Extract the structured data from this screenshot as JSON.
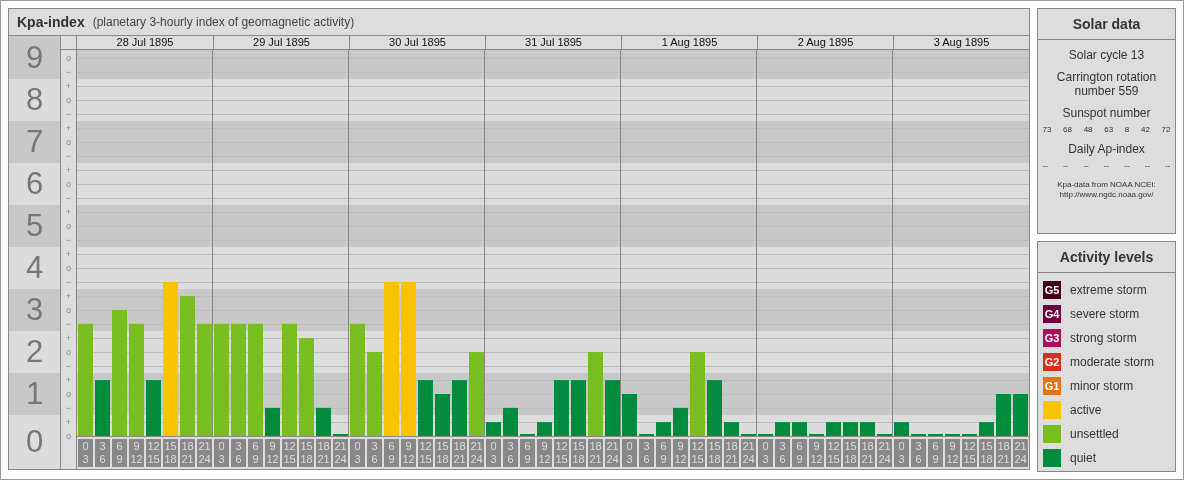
{
  "kpa_panel": {
    "title": "Kpa-index",
    "subtitle": "(planetary 3-hourly index of geomagnetic activity)",
    "days": [
      "28 Jul 1895",
      "29 Jul 1895",
      "30 Jul 1895",
      "31 Jul 1895",
      "1 Aug 1895",
      "2 Aug 1895",
      "3 Aug 1895"
    ],
    "step_labels": [
      "o",
      "−",
      "+",
      "o",
      "−",
      "+",
      "o",
      "−",
      "+",
      "o",
      "−",
      "+",
      "o",
      "−",
      "+",
      "o",
      "−",
      "+",
      "o",
      "−",
      "+",
      "o",
      "−",
      "+",
      "o",
      "−",
      "+",
      "o"
    ],
    "chart_data": {
      "type": "bar",
      "stacked": true,
      "grid": true,
      "ylim": [
        0,
        9.19
      ],
      "yticks": [
        {
          "value": 9,
          "label": "9"
        },
        {
          "value": 8,
          "label": "8"
        },
        {
          "value": 7,
          "label": "7"
        },
        {
          "value": 6,
          "label": "6"
        },
        {
          "value": 5,
          "label": "5"
        },
        {
          "value": 4,
          "label": "4"
        },
        {
          "value": 3,
          "label": "3"
        },
        {
          "value": 2,
          "label": "2"
        },
        {
          "value": 1,
          "label": "1"
        },
        {
          "value": 0,
          "label": "0"
        }
      ],
      "categories": [
        "0 3",
        "3 6",
        "6 9",
        "9 12",
        "12 15",
        "15 18",
        "18 21",
        "21 24",
        "0 3",
        "3 6",
        "6 9",
        "9 12",
        "12 15",
        "15 18",
        "18 21",
        "21 24",
        "0 3",
        "3 6",
        "6 9",
        "9 12",
        "12 15",
        "15 18",
        "18 21",
        "21 24",
        "0 3",
        "3 6",
        "6 9",
        "9 12",
        "12 15",
        "15 18",
        "18 21",
        "21 24",
        "0 3",
        "3 6",
        "6 9",
        "9 12",
        "12 15",
        "15 18",
        "18 21",
        "21 24",
        "0 3",
        "3 6",
        "6 9",
        "9 12",
        "12 15",
        "15 18",
        "18 21",
        "21 24",
        "0 3",
        "3 6",
        "6 9",
        "9 12",
        "12 15",
        "15 18",
        "18 21",
        "21 24"
      ],
      "series": [
        {
          "color": "#008c3c",
          "values": [
            null,
            1.33,
            null,
            null,
            1.33,
            null,
            null,
            null,
            null,
            null,
            null,
            0.67,
            null,
            null,
            0.67,
            0,
            null,
            null,
            null,
            null,
            1.33,
            1,
            1.33,
            null,
            0.33,
            0.67,
            0,
            0.33,
            1.33,
            1.33,
            null,
            1.33,
            1,
            0,
            0.33,
            0.67,
            null,
            1.33,
            0.33,
            0,
            0,
            0.33,
            0.33,
            0,
            0.33,
            0.33,
            0.33,
            0,
            0.33,
            0,
            0,
            0,
            0,
            0.33,
            1,
            1
          ]
        },
        {
          "color": "#78be20",
          "values": [
            2.67,
            null,
            3,
            2.67,
            null,
            null,
            3.33,
            2.67,
            2.67,
            2.67,
            2.67,
            null,
            2.67,
            2.33,
            null,
            null,
            2.67,
            2,
            null,
            null,
            null,
            null,
            null,
            2,
            null,
            null,
            null,
            null,
            null,
            null,
            2,
            null,
            null,
            null,
            null,
            null,
            2,
            null,
            null,
            null,
            null,
            null,
            null,
            null,
            null,
            null,
            null,
            null,
            null,
            null,
            null,
            null,
            null,
            null,
            null,
            null
          ]
        },
        {
          "color": "#f8c400",
          "values": [
            null,
            null,
            null,
            null,
            null,
            3.67,
            null,
            null,
            null,
            null,
            null,
            null,
            null,
            null,
            null,
            null,
            null,
            null,
            3.67,
            3.67,
            null,
            null,
            null,
            null,
            null,
            null,
            null,
            null,
            null,
            null,
            null,
            null,
            null,
            null,
            null,
            null,
            null,
            null,
            null,
            null,
            null,
            null,
            null,
            null,
            null,
            null,
            null,
            null,
            null,
            null,
            null,
            null,
            null,
            null,
            null,
            null
          ]
        }
      ]
    }
  },
  "solar_data": {
    "title": "Solar data",
    "solar_cycle": "Solar cycle 13",
    "carrington": "Carrington rotation number 559",
    "sunspot_title": "Sunspot number",
    "sunspot_numbers": [
      "73",
      "68",
      "48",
      "63",
      "8",
      "42",
      "72"
    ],
    "ap_title": "Daily Ap-index",
    "ap_values": [
      "--",
      "--",
      "--",
      "--",
      "--",
      "--",
      "--"
    ],
    "source": "Kpa-data from NOAA NCEI: http://www.ngdc.noaa.gov/"
  },
  "activity_levels": {
    "title": "Activity levels",
    "items": [
      {
        "badge": "G5",
        "label": "extreme storm",
        "color": "#46001e"
      },
      {
        "badge": "G4",
        "label": "severe storm",
        "color": "#6e0040"
      },
      {
        "badge": "G3",
        "label": "strong storm",
        "color": "#a8105e"
      },
      {
        "badge": "G2",
        "label": "moderate storm",
        "color": "#d82e1e"
      },
      {
        "badge": "G1",
        "label": "minor storm",
        "color": "#e2741a"
      },
      {
        "label": "active",
        "color": "#f8c400"
      },
      {
        "label": "unsettled",
        "color": "#78be20"
      },
      {
        "label": "quiet",
        "color": "#008c3c"
      }
    ]
  }
}
